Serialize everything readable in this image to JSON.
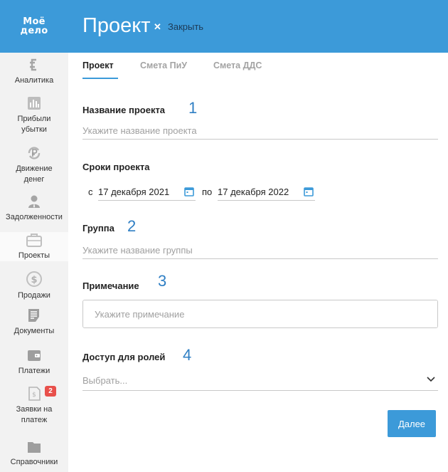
{
  "app": {
    "logo_line1": "Моё",
    "logo_line2": "дело",
    "title": "Проект",
    "close_label": "Закрыть"
  },
  "sidebar": {
    "items": [
      {
        "label": "Аналитика",
        "icon": "analytics-icon"
      },
      {
        "label": "Прибыли\nубытки",
        "icon": "bar-chart-icon"
      },
      {
        "label": "Движение\nденег",
        "icon": "ruble-cycle-icon"
      },
      {
        "label": "Задолженности",
        "icon": "person-icon"
      },
      {
        "label": "Проекты",
        "icon": "briefcase-icon"
      },
      {
        "label": "Продажи",
        "icon": "dollar-coin-icon"
      },
      {
        "label": "Документы",
        "icon": "document-icon"
      },
      {
        "label": "Платежи",
        "icon": "wallet-icon"
      },
      {
        "label": "Заявки на\nплатеж",
        "icon": "payment-request-icon",
        "badge": "2"
      },
      {
        "label": "Справочники",
        "icon": "folder-icon"
      }
    ]
  },
  "tabs": [
    {
      "label": "Проект",
      "active": true
    },
    {
      "label": "Смета ПиУ",
      "active": false
    },
    {
      "label": "Смета ДДС",
      "active": false
    }
  ],
  "form": {
    "name": {
      "label": "Название проекта",
      "number": "1",
      "placeholder": "Укажите название проекта",
      "value": ""
    },
    "dates": {
      "label": "Сроки проекта",
      "from_prefix": "с",
      "from_value": "17 декабря 2021",
      "to_prefix": "по",
      "to_value": "17 декабря 2022"
    },
    "group": {
      "label": "Группа",
      "number": "2",
      "placeholder": "Укажите название группы",
      "value": ""
    },
    "note": {
      "label": "Примечание",
      "number": "3",
      "placeholder": "Укажите примечание",
      "value": ""
    },
    "roles": {
      "label": "Доступ для ролей",
      "number": "4",
      "placeholder": "Выбрать..."
    }
  },
  "actions": {
    "next_label": "Далее"
  },
  "colors": {
    "accent": "#3c9ad9",
    "badge": "#e8504b",
    "annotation_number": "#2f7fc4",
    "sidebar_bg": "#f2f2f2"
  }
}
